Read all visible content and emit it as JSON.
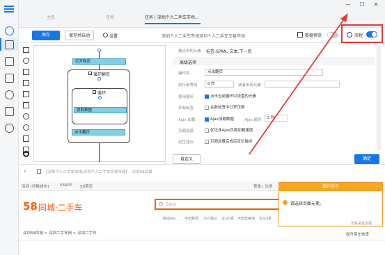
{
  "window": {
    "tabs": [
      "主页",
      "任务",
      "任务 | 深圳个人二手车市场..."
    ],
    "minimize": "—",
    "maximize": "☐",
    "close": "✕"
  },
  "toolbar": {
    "save": "保存",
    "save_and_start": "保存并启动",
    "settings": "设置",
    "task_title": "深圳个人二手车市场深圳个人二手车交易市场",
    "data_preview": "数据预览",
    "flow": "流程"
  },
  "workflow": {
    "nodes": {
      "open_page": "打开网页",
      "loop_page": "循环翻页",
      "loop": "循环",
      "extract": "提取数据",
      "click_page": "点击翻页"
    }
  },
  "settings": {
    "current_element_label": "要点击的元素",
    "current_element_value": "标签:SPAN, 文本:下一页",
    "section": "高级选项",
    "op_name_label": "操作名",
    "op_name_value": "点击翻页",
    "wait_label": "执行前等待",
    "wait_value": "0 秒",
    "or_appear_label": "或者出现元素",
    "loop_click_label": "使用循环",
    "loop_click_text": "点击当前循环中设置的元素",
    "new_tab_label": "开新标签",
    "new_tab_text": "在新标签中打开页面",
    "ajax_label": "Ajax 加载",
    "ajax_text": "Ajax加载数据",
    "ajax_timeout_label": "Ajax 超时",
    "ajax_timeout_value": "2 秒",
    "page_speed_label": "页面加速",
    "page_speed_text": "优化非Ajax页面加载速度",
    "anchor_label": "定位锚点",
    "anchor_text": "页面加载完成后定位锚点",
    "custom": "自定义",
    "confirm": "确定"
  },
  "browser": {
    "address": "【深圳个人二手车市场|深圳个人二手车交易市场】- 深圳58同城",
    "topbar_city": "深圳 [切换城市]",
    "topbar_app": "58APP",
    "topbar_home": "58首页",
    "login": "登录 | 注册",
    "logo_num": "58",
    "logo_text": "同城·二手车",
    "search_placeholder": "马自达",
    "hot_words": [
      "奥迪A6L",
      "丰田雅阁",
      "大众捷达",
      "宝马5系",
      "丰田凯美瑞",
      "宝马3系"
    ],
    "breadcrumb": "深圳58同城 > 深圳二手车网 > 深圳二手车",
    "promote": "提升卖车效率"
  },
  "popup": {
    "title": "操作提示",
    "message": "请选择页面元素。",
    "link": "查看采集流程"
  },
  "colors": {
    "accent": "#1677e8",
    "node": "#7fcfe8",
    "highlight": "#e53935",
    "popup": "#f5a623",
    "logo": "#ff5a00"
  }
}
